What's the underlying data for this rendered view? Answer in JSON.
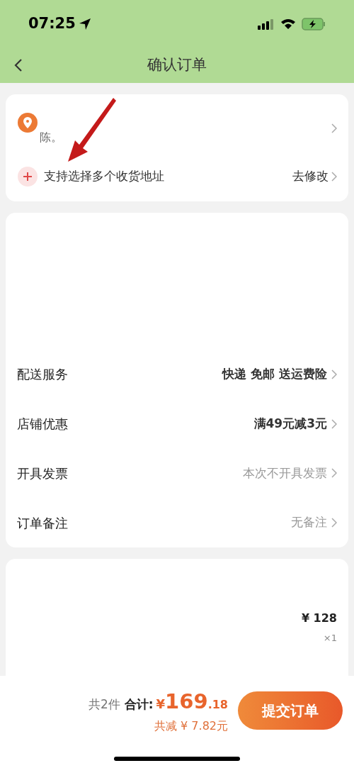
{
  "status_bar": {
    "time": "07:25"
  },
  "nav": {
    "title": "确认订单"
  },
  "address": {
    "name": "陈。",
    "multi_label": "支持选择多个收货地址",
    "edit_link": "去修改"
  },
  "options": [
    {
      "label": "配送服务",
      "value": "快递 免邮 送运费险",
      "kind": "strong"
    },
    {
      "label": "店铺优惠",
      "value": "满49元减3元",
      "kind": "strong"
    },
    {
      "label": "开具发票",
      "value": "本次不开具发票",
      "kind": "muted"
    },
    {
      "label": "订单备注",
      "value": "无备注",
      "kind": "muted"
    }
  ],
  "product": {
    "price": "¥ 128",
    "quantity": "×1"
  },
  "footer": {
    "count": "共2件",
    "total_label": "合计:",
    "currency": "¥",
    "total_int": "169",
    "total_dec": ".18",
    "discount": "共减 ¥ 7.82元",
    "submit": "提交订单"
  }
}
